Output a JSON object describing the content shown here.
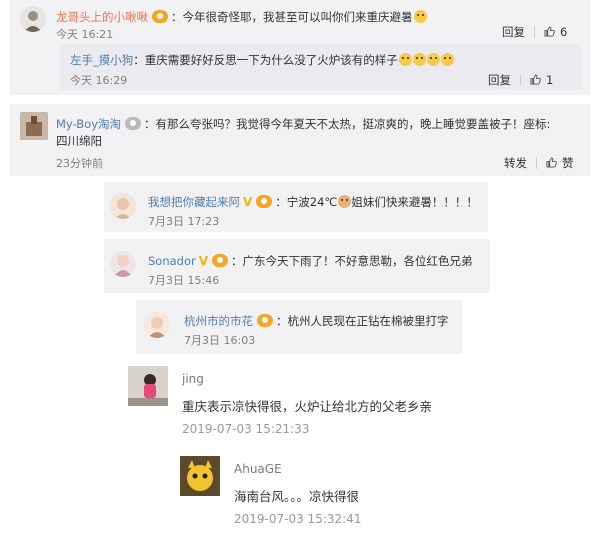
{
  "comments": [
    {
      "name": "龙哥头上的小啾啾",
      "text": "：今年很奇怪耶，我甚至可以叫你们来重庆避暑",
      "time": "今天 16:21",
      "reply_label": "回复",
      "like_count": "6",
      "reply": {
        "name": "左手_摸小狗",
        "text": "：重庆需要好好反思一下为什么没了火炉该有的样子",
        "time": "今天 16:29",
        "reply_label": "回复",
        "like_count": "1"
      }
    },
    {
      "name": "My-Boy淘淘",
      "text_line1": "：有那么夸张吗？我觉得今年夏天不太热，挺凉爽的，晚上睡觉要盖被子！座标:",
      "text_line2": "四川绵阳",
      "time": "23分钟前",
      "share_label": "转发",
      "like_label": "赞"
    },
    {
      "name": "我想把你藏起来阿",
      "text": "：宁波24℃",
      "text_tail": "姐妹们快来避暑！！！！",
      "time": "7月3日 17:23"
    },
    {
      "name": "Sonador",
      "text": "：广东今天下雨了！不好意思勒，各位红色兄弟",
      "time": "7月3日 15:46"
    },
    {
      "name": "杭州市的市花",
      "text": "：杭州人民现在正钻在棉被里打字",
      "time": "7月3日 16:03"
    },
    {
      "name": "jing",
      "text": "重庆表示凉快得很，火炉让给北方的父老乡亲",
      "time": "2019-07-03 15:21:33"
    },
    {
      "name": "AhuaGE",
      "text": "海南台风。。。凉快得很",
      "time": "2019-07-03 15:32:41"
    }
  ],
  "colors": {
    "card_bg": "#f2f2f5",
    "weibo_name": "#eb7350",
    "link_blue": "#507daf",
    "badge_orange": "#f5a623"
  }
}
